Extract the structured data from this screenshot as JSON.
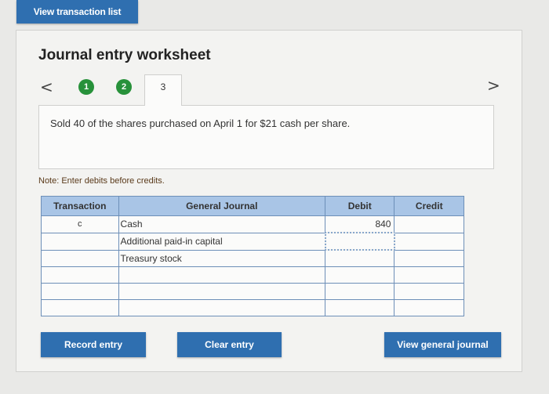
{
  "top_button": "View transaction list",
  "worksheet": {
    "title": "Journal entry worksheet",
    "steps": [
      "1",
      "2",
      "3"
    ],
    "prev_arrow": "<",
    "next_arrow": ">",
    "description": "Sold 40 of the shares purchased on April 1 for $21 cash per share.",
    "note": "Note: Enter debits before credits."
  },
  "table": {
    "headers": {
      "transaction": "Transaction",
      "account": "General Journal",
      "debit": "Debit",
      "credit": "Credit"
    },
    "rows": [
      {
        "transaction": "c",
        "account": "Cash",
        "debit": "840",
        "credit": ""
      },
      {
        "transaction": "",
        "account": "Additional paid-in capital",
        "debit": "",
        "credit": ""
      },
      {
        "transaction": "",
        "account": "Treasury stock",
        "debit": "",
        "credit": ""
      },
      {
        "transaction": "",
        "account": "",
        "debit": "",
        "credit": ""
      },
      {
        "transaction": "",
        "account": "",
        "debit": "",
        "credit": ""
      },
      {
        "transaction": "",
        "account": "",
        "debit": "",
        "credit": ""
      }
    ]
  },
  "buttons": {
    "record": "Record entry",
    "clear": "Clear entry",
    "view_journal": "View general journal"
  }
}
